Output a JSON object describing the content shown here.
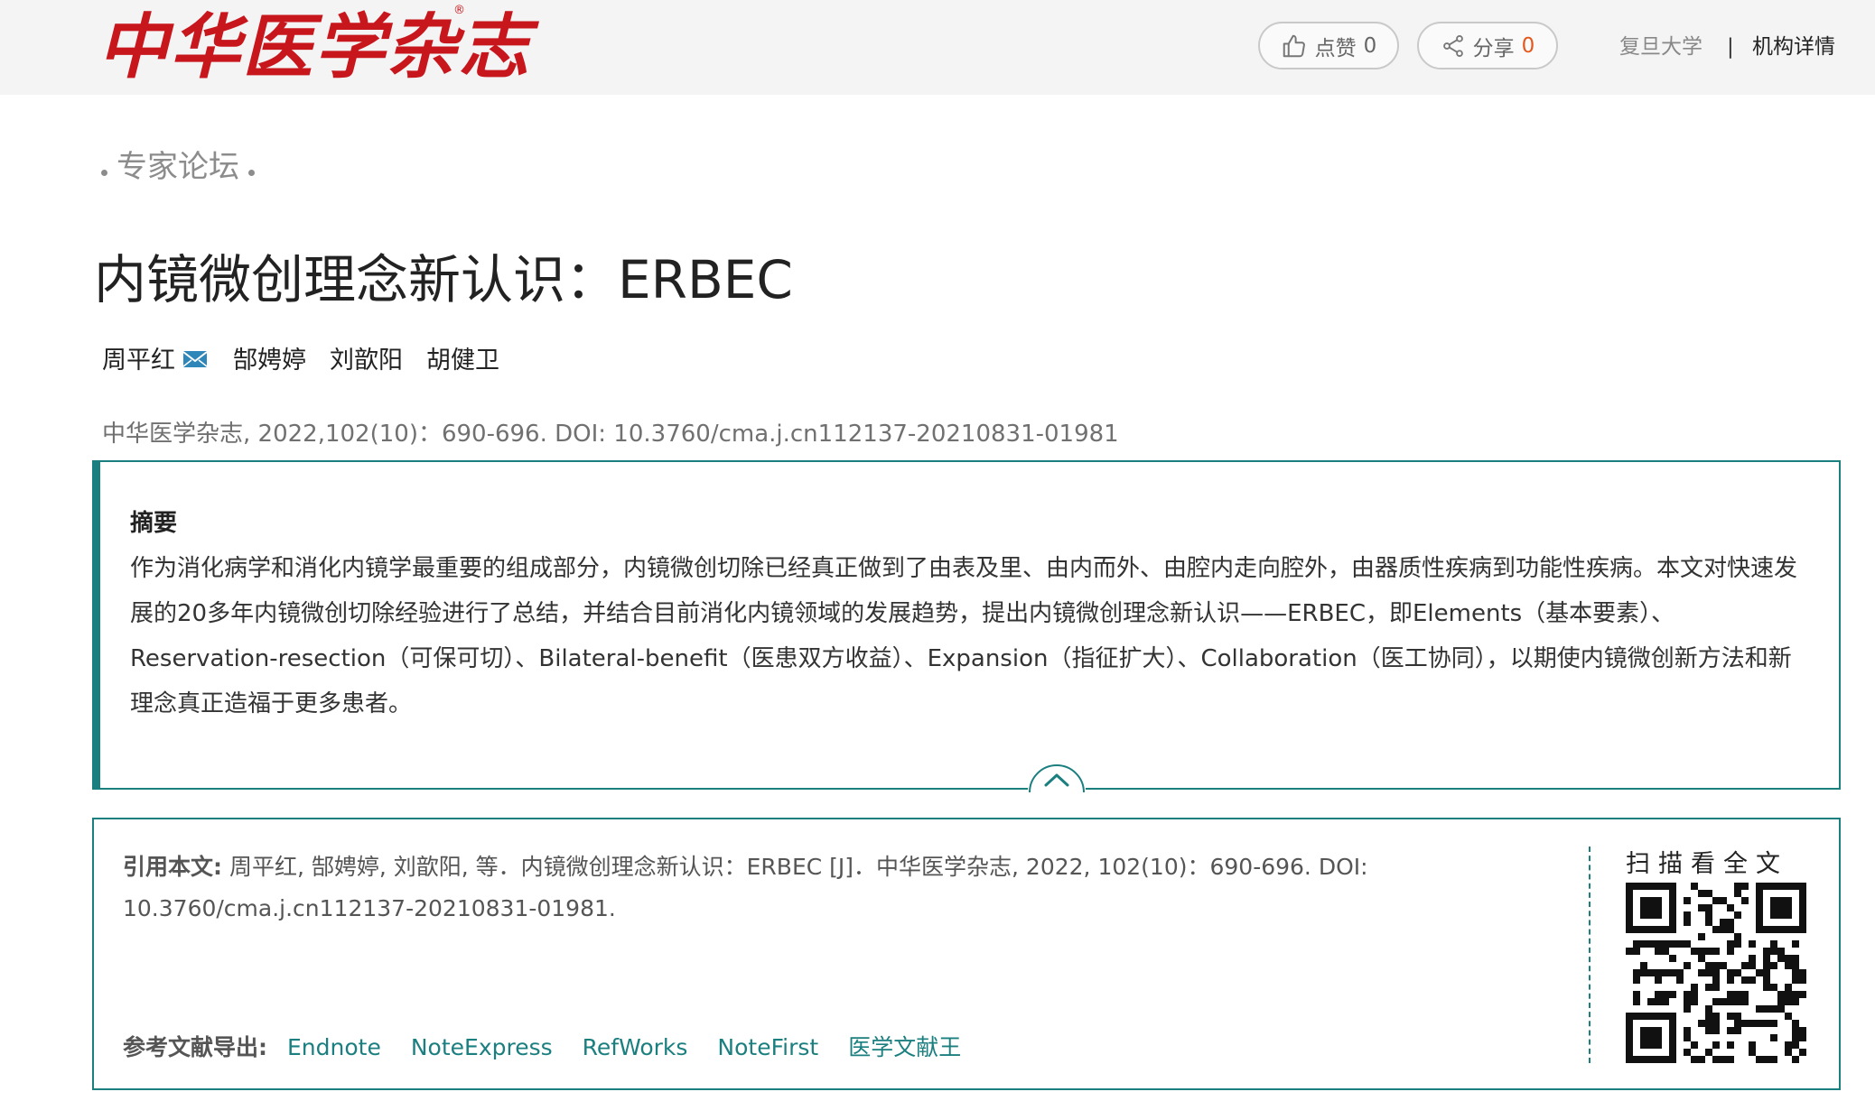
{
  "header": {
    "logo_text": "中华医学杂志",
    "logo_reg": "®",
    "like_label": "点赞",
    "like_count": "0",
    "share_label": "分享",
    "share_count": "0",
    "institution": "复旦大学",
    "separator": "|",
    "institution_detail": "机构详情"
  },
  "article": {
    "column": "专家论坛",
    "title": "内镜微创理念新认识：ERBEC",
    "authors": [
      "周平红",
      "郜娉婷",
      "刘歆阳",
      "胡健卫"
    ],
    "citation_line": "中华医学杂志, 2022,102(10)：690-696. DOI: 10.3760/cma.j.cn112137-20210831-01981"
  },
  "abstract": {
    "heading": "摘要",
    "text": "作为消化病学和消化内镜学最重要的组成部分，内镜微创切除已经真正做到了由表及里、由内而外、由腔内走向腔外，由器质性疾病到功能性疾病。本文对快速发展的20多年内镜微创切除经验进行了总结，并结合目前消化内镜领域的发展趋势，提出内镜微创理念新认识——ERBEC，即Elements（基本要素）、Reservation-resection（可保可切）、Bilateral-benefit（医患双方收益）、Expansion（指征扩大）、Collaboration（医工协同），以期使内镜微创新方法和新理念真正造福于更多患者。"
  },
  "cite": {
    "label": "引用本文:",
    "text": "周平红, 郜娉婷, 刘歆阳, 等．内镜微创理念新认识：ERBEC [J]．中华医学杂志, 2022, 102(10)：690-696. DOI: 10.3760/cma.j.cn112137-20210831-01981.",
    "export_label": "参考文献导出:",
    "export_links": [
      "Endnote",
      "NoteExpress",
      "RefWorks",
      "NoteFirst",
      "医学文献王"
    ],
    "qr_label": "扫描看全文"
  },
  "colors": {
    "brand_red": "#c8161d",
    "accent_teal": "#1b7f80",
    "share_orange": "#e4581c"
  }
}
